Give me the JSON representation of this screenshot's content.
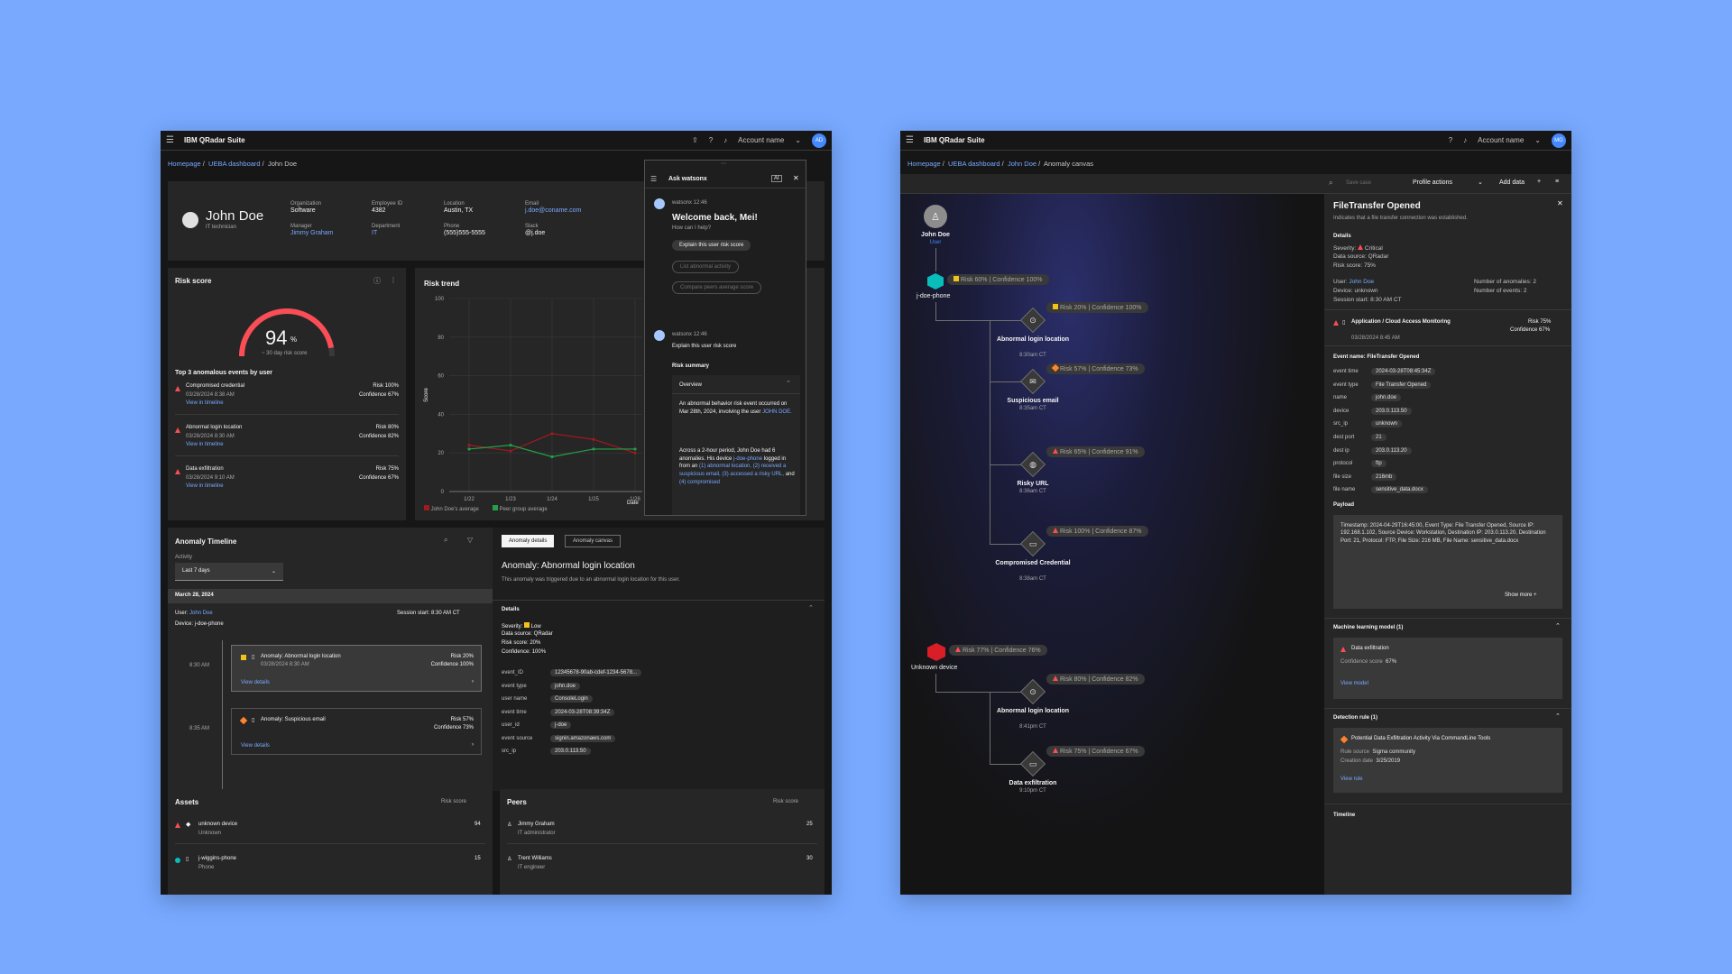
{
  "app": {
    "brand": "IBM QRadar Suite",
    "account": "Account name",
    "avatar_left": "AD",
    "avatar_right": "MG"
  },
  "left": {
    "breadcrumb": {
      "home": "Homepage",
      "dash": "UEBA dashboard",
      "current": "John Doe"
    },
    "profile": {
      "name": "John Doe",
      "title": "IT technician",
      "fields": [
        {
          "label": "Organization",
          "value": "Software"
        },
        {
          "label": "Employee ID",
          "value": "4382"
        },
        {
          "label": "Location",
          "value": "Austin, TX"
        },
        {
          "label": "Email",
          "value": "j.doe@coname.com"
        },
        {
          "label": "Manager",
          "value": "Jimmy Graham"
        },
        {
          "label": "Department",
          "value": "IT"
        },
        {
          "label": "Phone",
          "value": "(555)555-5555"
        },
        {
          "label": "Slack",
          "value": "@j.doe"
        }
      ]
    },
    "risk_score": {
      "title": "Risk score",
      "value": "94",
      "unit": "%",
      "sub": "~ 30 day risk score",
      "level": 0.94,
      "events_title": "Top 3 anomalous events by user",
      "events": [
        {
          "name": "Compromised credential",
          "date": "03/28/2024 8:38 AM",
          "risk": "Risk 100%",
          "conf": "Confidence 67%",
          "link": "View in timeline"
        },
        {
          "name": "Abnormal login location",
          "date": "03/28/2024 8:30 AM",
          "risk": "Risk 80%",
          "conf": "Confidence 82%",
          "link": "View in timeline"
        },
        {
          "name": "Data exfiltration",
          "date": "03/28/2024 9:10 AM",
          "risk": "Risk 75%",
          "conf": "Confidence 67%",
          "link": "View in timeline"
        }
      ]
    },
    "risk_trend": {
      "title": "Risk trend",
      "ylabel": "Score",
      "xlabel": "Date",
      "legend": [
        "John Doe's average",
        "Peer group average"
      ]
    },
    "chart_data": {
      "type": "line",
      "title": "Risk trend",
      "xlabel": "Date",
      "ylabel": "Score",
      "ylim": [
        0,
        100
      ],
      "yticks": [
        0,
        20,
        40,
        60,
        80,
        100
      ],
      "categories": [
        "1/22",
        "1/23",
        "1/24",
        "1/25",
        "1/26"
      ],
      "series": [
        {
          "name": "John Doe's average",
          "color": "#a2191f",
          "values": [
            24,
            21,
            30,
            27,
            20
          ]
        },
        {
          "name": "Peer group average",
          "color": "#24a148",
          "values": [
            22,
            24,
            18,
            22,
            22
          ]
        }
      ]
    },
    "watsonx": {
      "title": "Ask watsonx",
      "ai": "AI",
      "msg1_meta": "watsonx 12:46",
      "welcome": "Welcome back, Mei!",
      "help": "How can I help?",
      "suggestions": [
        "Explain this user risk score",
        "List abnormal activity",
        "Compare peers average score"
      ],
      "msg2_meta": "watsonx 12:46",
      "question": "Explain this user risk score",
      "summary_title": "Risk summary",
      "overview": "Overview",
      "p1a": "An abnormal behavior risk event occurred on Mar 28th, 2024, involving the user ",
      "p1b": "JOHN DOE.",
      "p2a": "Across a 2-hour period, John Doe had 6 anomalies. His device ",
      "p2b": "j-doe-phone",
      "p2c": " logged in from an ",
      "p2d": "(1) abnormal location, (2) received a suspicious email, (3) accessed a risky URL,",
      "p2e": " and ",
      "p2f": "(4) compromised"
    },
    "timeline": {
      "title": "Anomaly Timeline",
      "activity": "Activity",
      "range": "Last 7 days",
      "date": "March 28, 2024",
      "user_label": "User: ",
      "user": "John Doe",
      "device": "Device: j-doe-phone",
      "session": "Session start: 8:30 AM CT",
      "items": [
        {
          "time": "8:30 AM",
          "name": "Anomaly: Abnormal login location",
          "date": "03/28/2024 8:30 AM",
          "risk": "Risk 20%",
          "conf": "Confidence 100%",
          "link": "View details"
        },
        {
          "time": "8:35 AM",
          "name": "Anomaly: Suspicious email",
          "date": "",
          "risk": "Risk 57%",
          "conf": "Confidence 73%",
          "link": "View details"
        }
      ]
    },
    "details": {
      "tabs": [
        "Anomaly details",
        "Anomaly canvas"
      ],
      "title": "Anomaly: Abnormal login location",
      "desc": "This anomaly was triggered due to an abnormal login location for this user.",
      "section": "Details",
      "severity": "Severity:",
      "severity_val": "Low",
      "source": "Data source: QRadar",
      "score": "Risk score: 20%",
      "conf": "Confidence: 100%",
      "rows": [
        {
          "k": "event_ID",
          "v": "12345678-90ab-cdef-1234-5678..."
        },
        {
          "k": "event type",
          "v": "john.doe"
        },
        {
          "k": "user name",
          "v": "ConsoleLogin"
        },
        {
          "k": "event time",
          "v": "2024-03-28T08:39:34Z"
        },
        {
          "k": "user_id",
          "v": "j-doe"
        },
        {
          "k": "event source",
          "v": "signin.amazonaws.com"
        },
        {
          "k": "src_ip",
          "v": "203.0.113.50"
        }
      ]
    },
    "assets": {
      "title": "Assets",
      "col": "Risk score",
      "items": [
        {
          "name": "unknown device",
          "sub": "Unknown",
          "score": "94"
        },
        {
          "name": "j-wiggins-phone",
          "sub": "Phone",
          "score": "15"
        }
      ]
    },
    "peers": {
      "title": "Peers",
      "col": "Risk score",
      "items": [
        {
          "name": "Jimmy Graham",
          "sub": "IT administrator",
          "score": "25"
        },
        {
          "name": "Trent Williams",
          "sub": "IT engineer",
          "score": "30"
        }
      ]
    }
  },
  "right": {
    "breadcrumb": {
      "home": "Homepage",
      "dash": "UEBA dashboard",
      "user": "John Doe",
      "current": "Anomaly canvas"
    },
    "toolbar": {
      "save": "Save case",
      "profile": "Profile actions",
      "add": "Add data"
    },
    "canvas": {
      "user": {
        "name": "John Doe",
        "role": "User"
      },
      "device1": {
        "name": "j-doe-phone",
        "risk": "Risk 60%",
        "conf": "Confidence 100%"
      },
      "device2": {
        "name": "Unknown device",
        "risk": "Risk 77%",
        "conf": "Confidence 76%"
      },
      "nodes": [
        {
          "name": "Abnormal login location",
          "time": "8:30am CT",
          "risk": "Risk 20%",
          "conf": "Confidence 100%"
        },
        {
          "name": "Suspicious email",
          "time": "8:35am CT",
          "risk": "Risk 57%",
          "conf": "Confidence 73%"
        },
        {
          "name": "Risky URL",
          "time": "8:36am CT",
          "risk": "Risk 65%",
          "conf": "Confidence 91%"
        },
        {
          "name": "Compromised Credential",
          "time": "8:38am CT",
          "risk": "Risk 100%",
          "conf": "Confidence 87%"
        },
        {
          "name": "Abnormal login location",
          "time": "8:41pm CT",
          "risk": "Risk 80%",
          "conf": "Confidence 82%"
        },
        {
          "name": "Data exfiltration",
          "time": "9:10pm CT",
          "risk": "Risk 75%",
          "conf": "Confidence 67%"
        }
      ]
    },
    "side": {
      "title": "FileTransfer Opened",
      "desc": "Indicates that a file transfer connection was established.",
      "details": "Details",
      "severity": "Severity:",
      "severity_val": "Critical",
      "source": "Data source: QRadar",
      "score": "Risk score: 75%",
      "user_label": "User: ",
      "user": "John Doe",
      "device": "Device: unknown",
      "session": "Session start: 8:30 AM CT",
      "anomalies": "Number of anomalies: 2",
      "events": "Number of events: 2",
      "app_name": "Application / Cloud Access Monitoring",
      "app_date": "03/28/2024 8:45 AM",
      "app_risk": "Risk 75%",
      "app_conf": "Confidence 67%",
      "event_name": "Event name: FileTransfer Opened",
      "rows": [
        {
          "k": "event time",
          "v": "2024-03-28T08:45:34Z"
        },
        {
          "k": "event type",
          "v": "File Transfer Opened"
        },
        {
          "k": "name",
          "v": "john.doe"
        },
        {
          "k": "device",
          "v": "203.0.113.50"
        },
        {
          "k": "src_ip",
          "v": "unknown"
        },
        {
          "k": "dest port",
          "v": "21"
        },
        {
          "k": "dest ip",
          "v": "203.0.113.20"
        },
        {
          "k": "protocol",
          "v": "ftp"
        },
        {
          "k": "file size",
          "v": "216mb"
        },
        {
          "k": "file name",
          "v": "sensitive_data.docx"
        }
      ],
      "payload_title": "Payload",
      "payload": "Timestamp: 2024-04-29T16:45:00, Event Type: File Transfer Opened, Source IP: 192.168.1.102, Source Device: Workstation, Destination IP: 203.0.113.20, Destination Port: 21, Protocol: FTP, File Size: 216 MB, File Name: sensitive_data.docx",
      "show_more": "Show more",
      "ml_title": "Machine learning model (1)",
      "ml_name": "Data exfiltration",
      "ml_conf_label": "Confidence score",
      "ml_conf": "67%",
      "ml_link": "View model",
      "rule_title": "Detection rule (1)",
      "rule_name": "Potential Data Exfiltration Activity Via CommandLine Tools",
      "rule_source_label": "Rule source",
      "rule_source": "Sigma community",
      "rule_date_label": "Creation date",
      "rule_date": "3/25/2019",
      "rule_link": "View rule",
      "timeline": "Timeline"
    }
  }
}
